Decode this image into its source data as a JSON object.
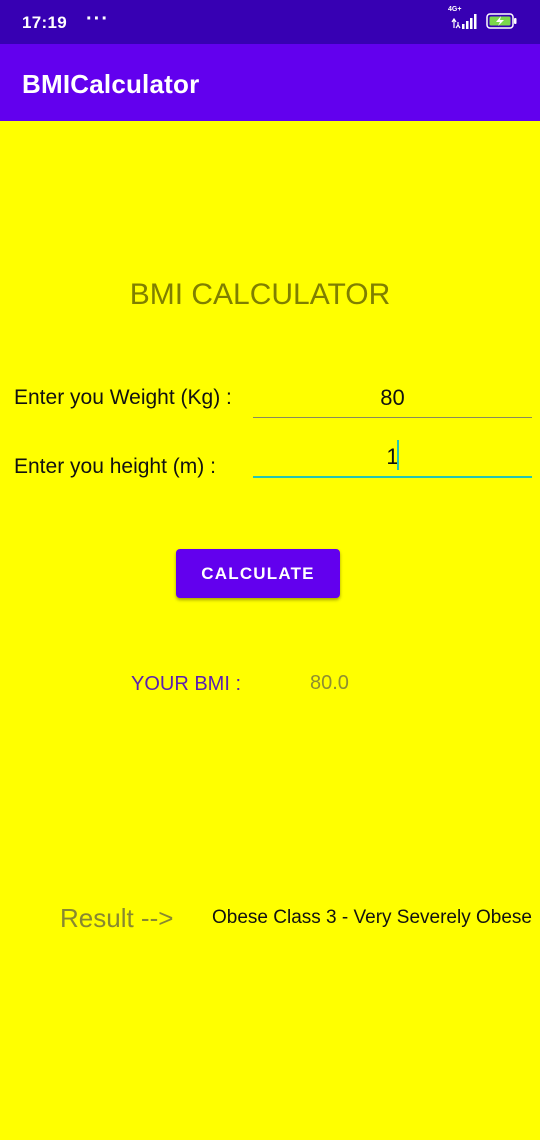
{
  "status_bar": {
    "time": "17:19",
    "dots": "···",
    "network": "4G+",
    "icons": [
      "signal-icon",
      "battery-charging-icon"
    ]
  },
  "app_bar": {
    "title": "BMICalculator"
  },
  "main": {
    "heading": "BMI CALCULATOR",
    "weight_label": "Enter you Weight (Kg) :",
    "weight_value": "80",
    "height_label": "Enter you height (m) :",
    "height_value": "1",
    "calculate_label": "CALCULATE",
    "bmi_label": "YOUR BMI :",
    "bmi_value": "80.0",
    "result_label": "Result -->",
    "result_value": "Obese Class 3 - Very Severely Obese"
  },
  "colors": {
    "status_bar": "#3700b3",
    "app_bar": "#6200ee",
    "background": "#ffff00",
    "accent": "#26c6b0"
  }
}
